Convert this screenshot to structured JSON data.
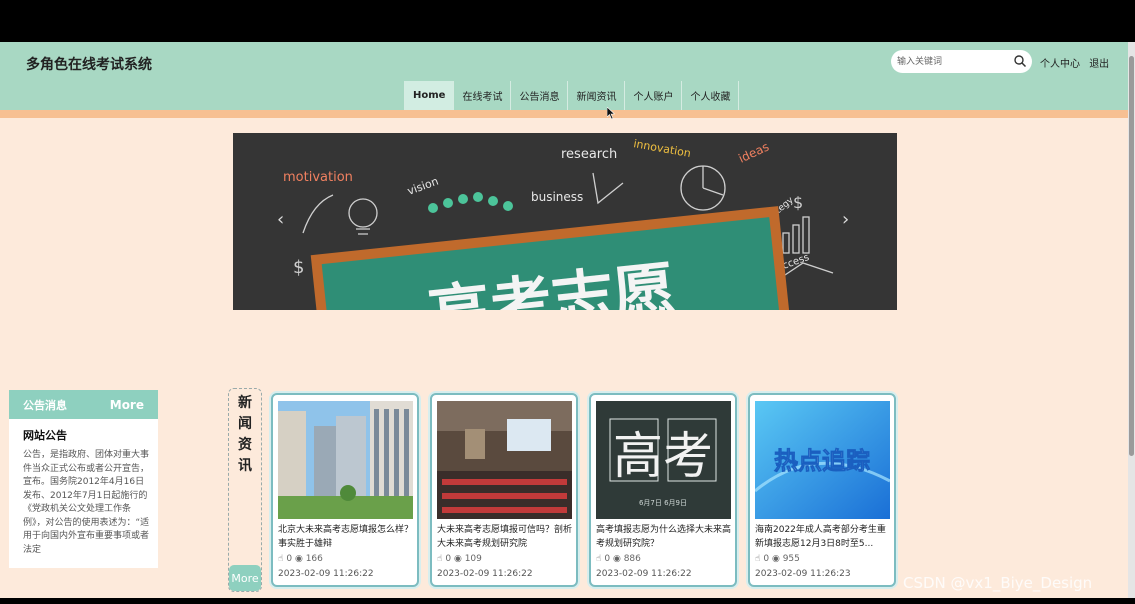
{
  "header": {
    "site_title": "多角色在线考试系统",
    "search_placeholder": "输入关键词",
    "user_center": "个人中心",
    "logout": "退出"
  },
  "nav": [
    {
      "label": "Home",
      "active": true
    },
    {
      "label": "在线考试"
    },
    {
      "label": "公告消息"
    },
    {
      "label": "新闻资讯"
    },
    {
      "label": "个人账户"
    },
    {
      "label": "个人收藏"
    }
  ],
  "banner": {
    "headline": "高考志愿",
    "words": [
      "motivation",
      "vision",
      "research",
      "innovation",
      "ideas",
      "business",
      "strategy",
      "success"
    ]
  },
  "notice": {
    "header": "公告消息",
    "more": "More",
    "title": "网站公告",
    "body": "公告，是指政府、团体对重大事件当众正式公布或者公开宣告，宣布。国务院2012年4月16日发布、2012年7月1日起施行的《党政机关公文处理工作条例》，对公告的使用表述为：“适用于向国内外宣布重要事项或者法定"
  },
  "news": {
    "label": "新闻资讯",
    "more": "More",
    "items": [
      {
        "title": "北京大未来高考志愿填报怎么样？事实胜于雄辩",
        "likes": "0",
        "views": "166",
        "date": "2023-02-09 11:26:22"
      },
      {
        "title": "大未来高考志愿填报可信吗？剖析大未来高考规划研究院",
        "likes": "0",
        "views": "109",
        "date": "2023-02-09 11:26:22"
      },
      {
        "title": "高考填报志愿为什么选择大未来高考规划研究院？",
        "likes": "0",
        "views": "886",
        "date": "2023-02-09 11:26:22",
        "image_text": "高考",
        "image_subtext": "6月7日 6月9日"
      },
      {
        "title": "海南2022年成人高考部分考生重新填报志愿12月3日8时至5...",
        "likes": "0",
        "views": "955",
        "date": "2023-02-09 11:26:23",
        "image_text": "热点追踪"
      }
    ]
  },
  "watermark": "CSDN @vx1_Biye_Design",
  "colors": {
    "header": "#a8d8c3",
    "accent": "#f7c092",
    "page_bg": "#fdeadb",
    "teal": "#8ed0bf"
  }
}
